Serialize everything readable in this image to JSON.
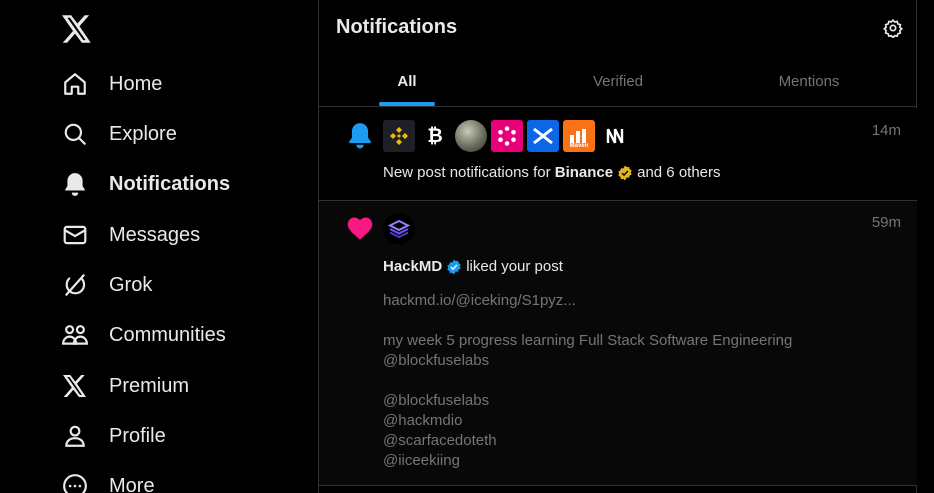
{
  "sidebar": {
    "items": [
      {
        "label": "Home",
        "icon": "home-icon"
      },
      {
        "label": "Explore",
        "icon": "search-icon"
      },
      {
        "label": "Notifications",
        "icon": "bell-icon"
      },
      {
        "label": "Messages",
        "icon": "envelope-icon"
      },
      {
        "label": "Grok",
        "icon": "grok-icon"
      },
      {
        "label": "Communities",
        "icon": "communities-icon"
      },
      {
        "label": "Premium",
        "icon": "x-icon"
      },
      {
        "label": "Profile",
        "icon": "person-icon"
      },
      {
        "label": "More",
        "icon": "more-icon"
      }
    ]
  },
  "header": {
    "title": "Notifications"
  },
  "tabs": [
    {
      "label": "All"
    },
    {
      "label": "Verified"
    },
    {
      "label": "Mentions"
    }
  ],
  "notifications": [
    {
      "time": "14m",
      "text_prefix": "New post notifications for",
      "account": "Binance",
      "text_suffix": "and 6 others",
      "avatars": [
        "binance",
        "bitcoin",
        "photo",
        "polkadot",
        "swap",
        "maven",
        "wn"
      ],
      "avatar_text": {
        "maven": "Maven"
      },
      "colors": {
        "bell": "#1d9bf0",
        "gold_badge": "#e2b719"
      }
    },
    {
      "time": "59m",
      "account": "HackMD",
      "action": "liked your post",
      "post_lines": [
        "hackmd.io/@iceking/S1pyz...",
        "",
        "my week 5 progress learning Full Stack Software Engineering",
        "@blockfuselabs",
        "",
        "@blockfuselabs",
        "@hackmdio",
        "@scarfacedoteth",
        "@iiceekiing"
      ],
      "colors": {
        "heart": "#f91880",
        "blue_badge": "#1d9bf0"
      }
    }
  ]
}
